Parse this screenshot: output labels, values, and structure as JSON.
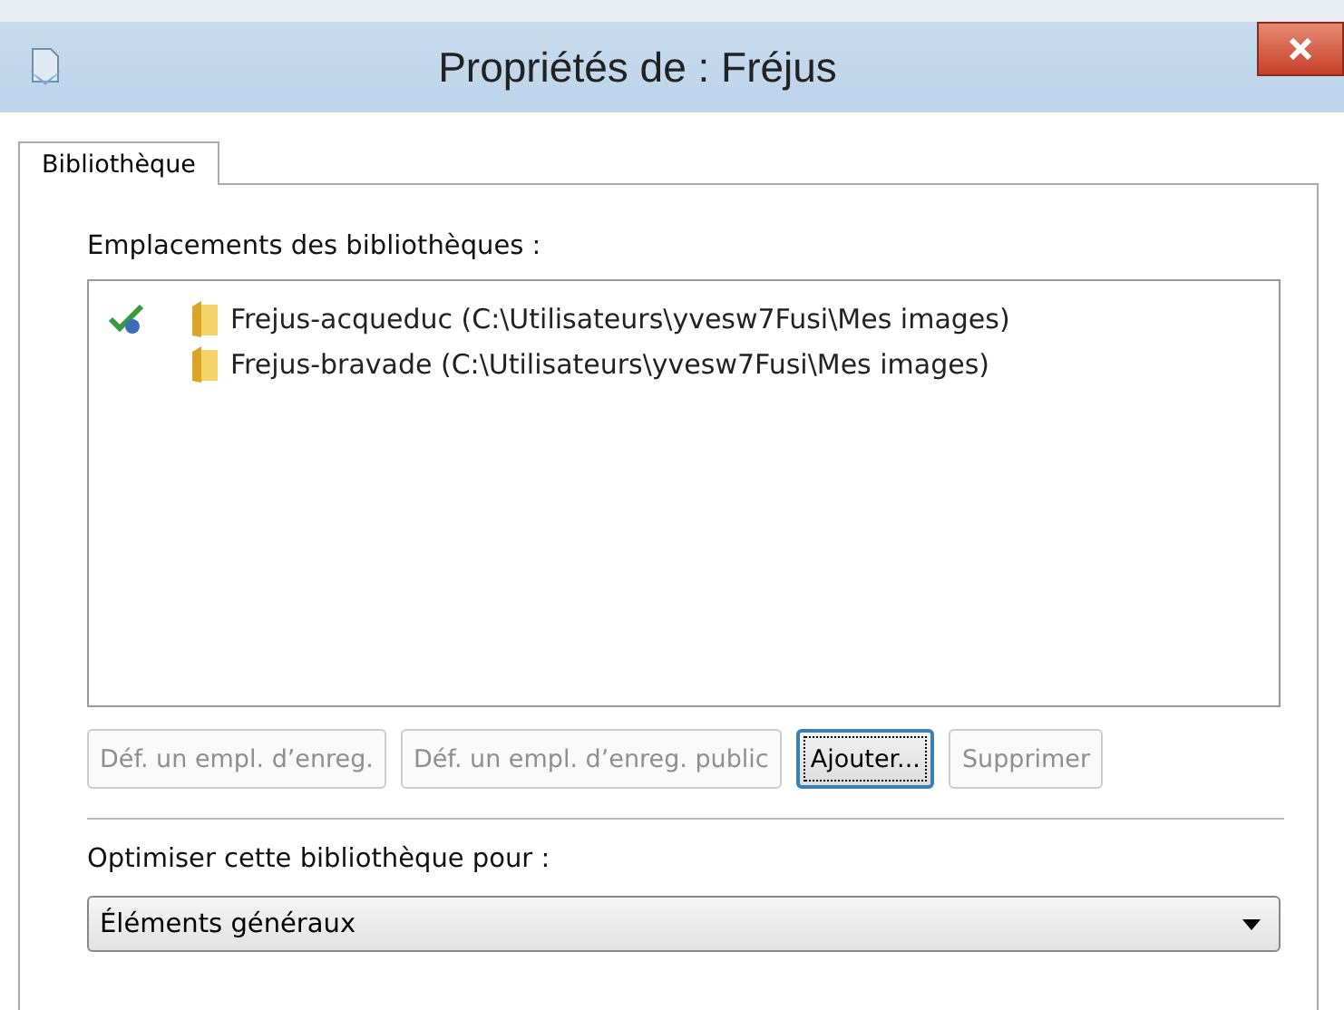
{
  "window": {
    "title": "Propriétés de : Fréjus"
  },
  "tabs": [
    {
      "label": "Bibliothèque",
      "selected": true
    }
  ],
  "locations": {
    "label": "Emplacements des bibliothèques :",
    "items": [
      {
        "name": "Frejus-acqueduc (C:\\Utilisateurs\\yvesw7Fusi\\Mes images)",
        "default": true
      },
      {
        "name": "Frejus-bravade (C:\\Utilisateurs\\yvesw7Fusi\\Mes images)",
        "default": false
      }
    ]
  },
  "buttons": [
    {
      "label": "Déf. un empl. d’enreg.",
      "disabled": true,
      "focused": false
    },
    {
      "label": "Déf. un empl. d’enreg. public",
      "disabled": true,
      "focused": false
    },
    {
      "label": "Ajouter...",
      "disabled": false,
      "focused": true
    },
    {
      "label": "Supprimer",
      "disabled": true,
      "focused": false
    }
  ],
  "optimize": {
    "label": "Optimiser cette bibliothèque pour :",
    "value": "Éléments généraux"
  }
}
